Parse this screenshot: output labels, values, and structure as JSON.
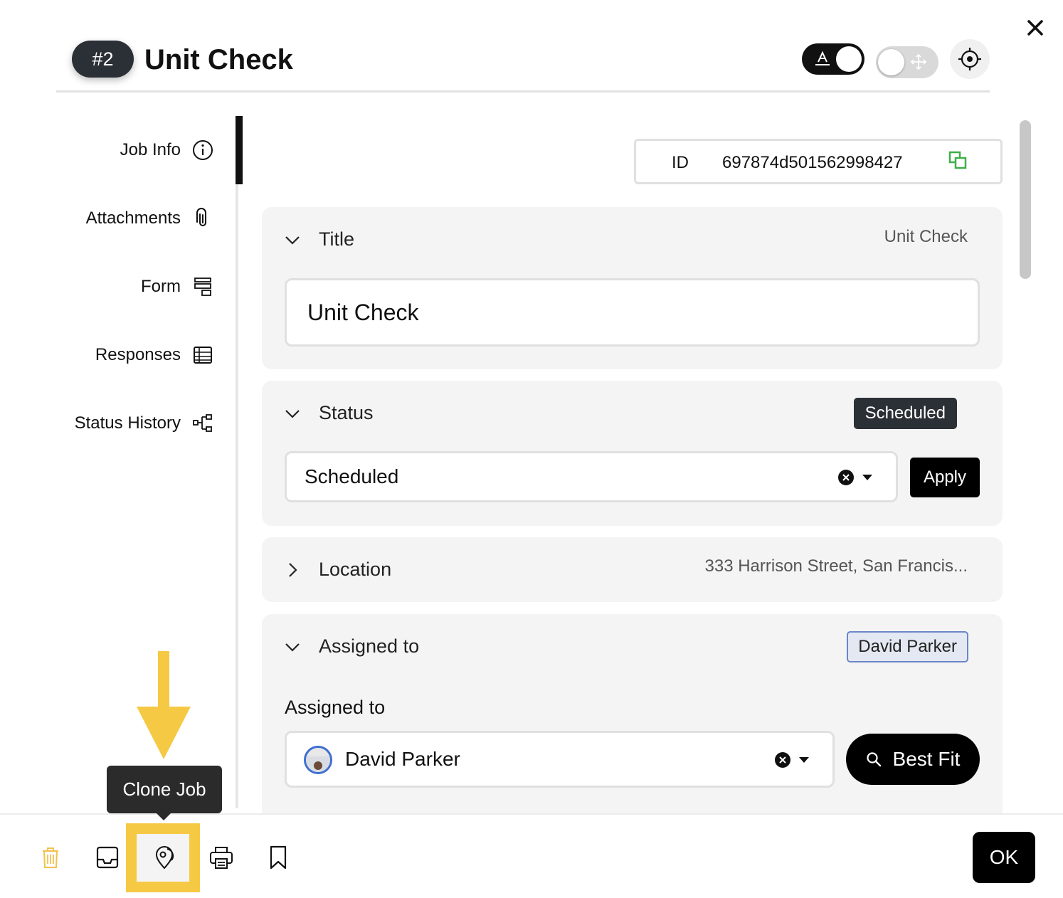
{
  "header": {
    "job_number": "#2",
    "title": "Unit Check"
  },
  "sidebar": {
    "items": [
      {
        "label": "Job Info",
        "icon": "info-icon"
      },
      {
        "label": "Attachments",
        "icon": "paperclip-icon"
      },
      {
        "label": "Form",
        "icon": "form-icon"
      },
      {
        "label": "Responses",
        "icon": "table-icon"
      },
      {
        "label": "Status History",
        "icon": "hierarchy-icon"
      }
    ]
  },
  "job_id": {
    "label": "ID",
    "value": "697874d501562998427"
  },
  "title_section": {
    "heading": "Title",
    "summary": "Unit Check",
    "input_value": "Unit Check"
  },
  "status_section": {
    "heading": "Status",
    "badge": "Scheduled",
    "selected": "Scheduled",
    "apply_label": "Apply"
  },
  "location_section": {
    "heading": "Location",
    "summary": "333 Harrison Street, San Francis..."
  },
  "assigned_section": {
    "heading": "Assigned to",
    "badge": "David Parker",
    "field_label": "Assigned to",
    "selected": "David Parker",
    "best_fit_label": "Best Fit"
  },
  "tooltip": {
    "text": "Clone Job"
  },
  "footer": {
    "ok_label": "OK"
  },
  "colors": {
    "highlight": "#f6c945",
    "dark": "#2b3036",
    "copy_icon": "#3fae49",
    "trash_icon": "#f2c14e"
  }
}
